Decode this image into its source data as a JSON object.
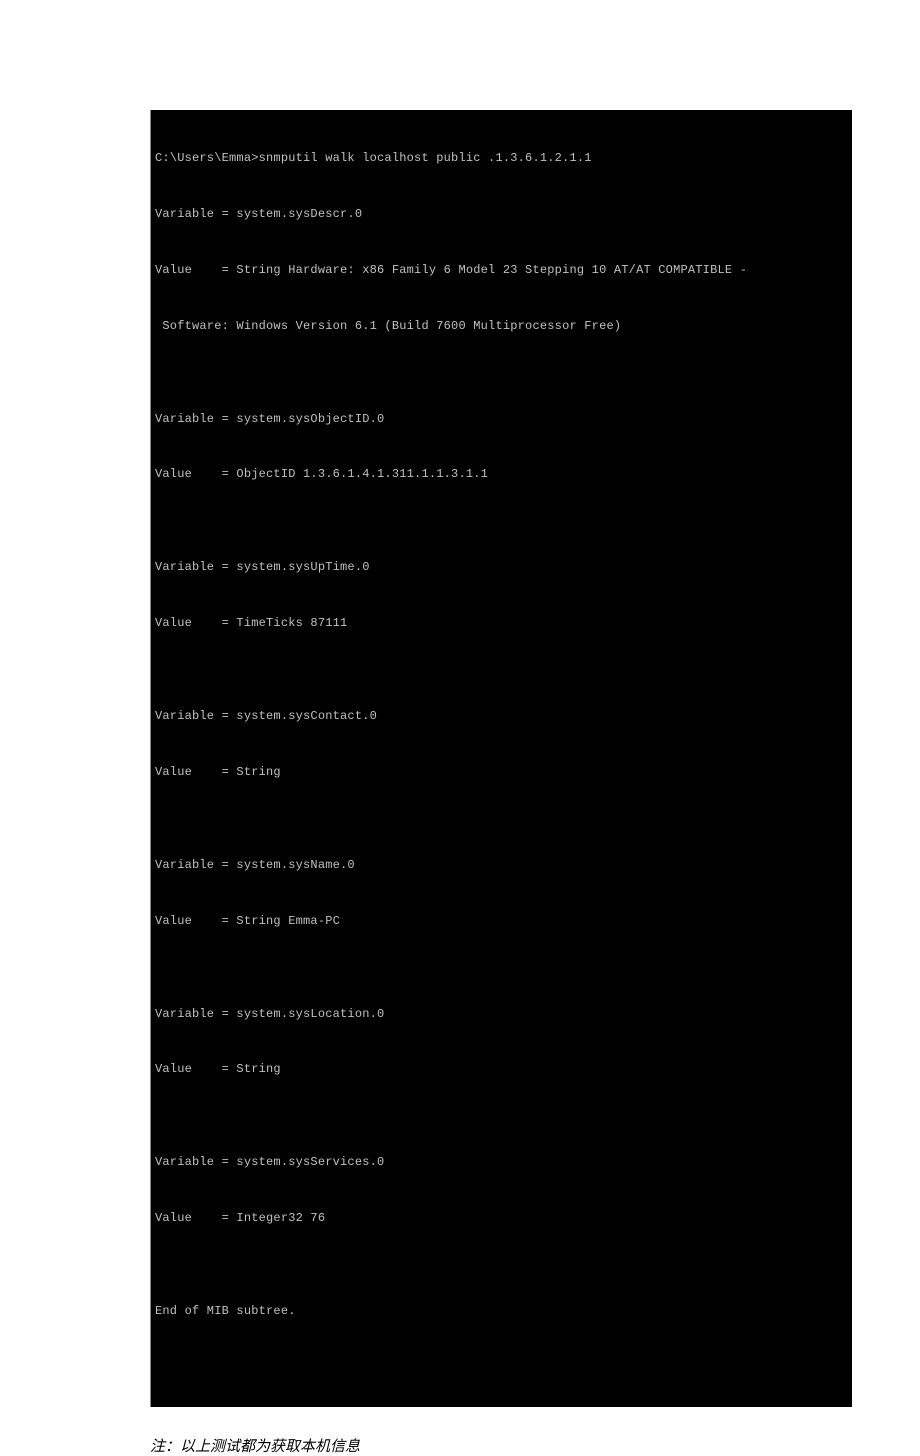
{
  "terminal": {
    "lines": [
      "C:\\Users\\Emma>snmputil walk localhost public .1.3.6.1.2.1.1",
      "Variable = system.sysDescr.0",
      "Value    = String Hardware: x86 Family 6 Model 23 Stepping 10 AT/AT COMPATIBLE -",
      " Software: Windows Version 6.1 (Build 7600 Multiprocessor Free)",
      "",
      "Variable = system.sysObjectID.0",
      "Value    = ObjectID 1.3.6.1.4.1.311.1.1.3.1.1",
      "",
      "Variable = system.sysUpTime.0",
      "Value    = TimeTicks 87111",
      "",
      "Variable = system.sysContact.0",
      "Value    = String",
      "",
      "Variable = system.sysName.0",
      "Value    = String Emma-PC",
      "",
      "Variable = system.sysLocation.0",
      "Value    = String",
      "",
      "Variable = system.sysServices.0",
      "Value    = Integer32 76",
      "",
      "End of MIB subtree.",
      ""
    ]
  },
  "note_text": "注：以上测试都为获取本机信息"
}
